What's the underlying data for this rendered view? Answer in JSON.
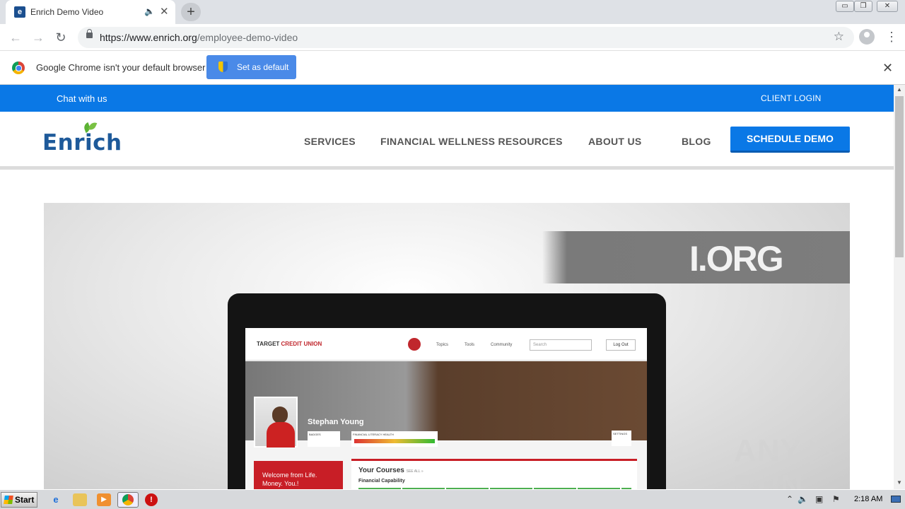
{
  "browser": {
    "tab": {
      "title": "Enrich Demo Video",
      "audio_icon": "speaker-icon",
      "close_glyph": "✕"
    },
    "new_tab_glyph": "+",
    "window_controls": [
      "▭",
      "❐",
      "✕"
    ],
    "url": {
      "host": "https://www.enrich.org",
      "path": "/employee-demo-video"
    },
    "nav": {
      "back": "←",
      "forward": "→",
      "reload": "↻",
      "star": "☆",
      "menu": "⋮"
    }
  },
  "infobar": {
    "message": "Google Chrome isn't your default browser",
    "button_label": "Set as default",
    "close_glyph": "✕"
  },
  "site": {
    "topbar": {
      "chat": "Chat with us",
      "client_login": "CLIENT LOGIN"
    },
    "logo": "Enrich",
    "nav": [
      "SERVICES",
      "FINANCIAL WELLNESS RESOURCES",
      "ABOUT US",
      "BLOG"
    ],
    "cta": "SCHEDULE DEMO",
    "accent_color": "#0a78e6"
  },
  "video": {
    "banner_text": "I.ORG",
    "screen": {
      "brand_main": "TARGET",
      "brand_accent": " CREDIT UNION",
      "nav": [
        "Topics",
        "Tools",
        "Community"
      ],
      "search_placeholder": "Search",
      "logout": "Log Out",
      "user_name": "Stephan Young",
      "badges_label": "BADGES",
      "health_label": "FINANCIAL LITERACY HEALTH",
      "settings_label": "SETTINGS",
      "welcome": "Welcome from Life. Money. You.!",
      "courses_title": "Your Courses",
      "courses_link": "SEE ALL »",
      "course_name": "Financial Capability"
    }
  },
  "watermark": "ANY ▷ RUN",
  "taskbar": {
    "start": "Start",
    "time": "2:18 AM"
  }
}
